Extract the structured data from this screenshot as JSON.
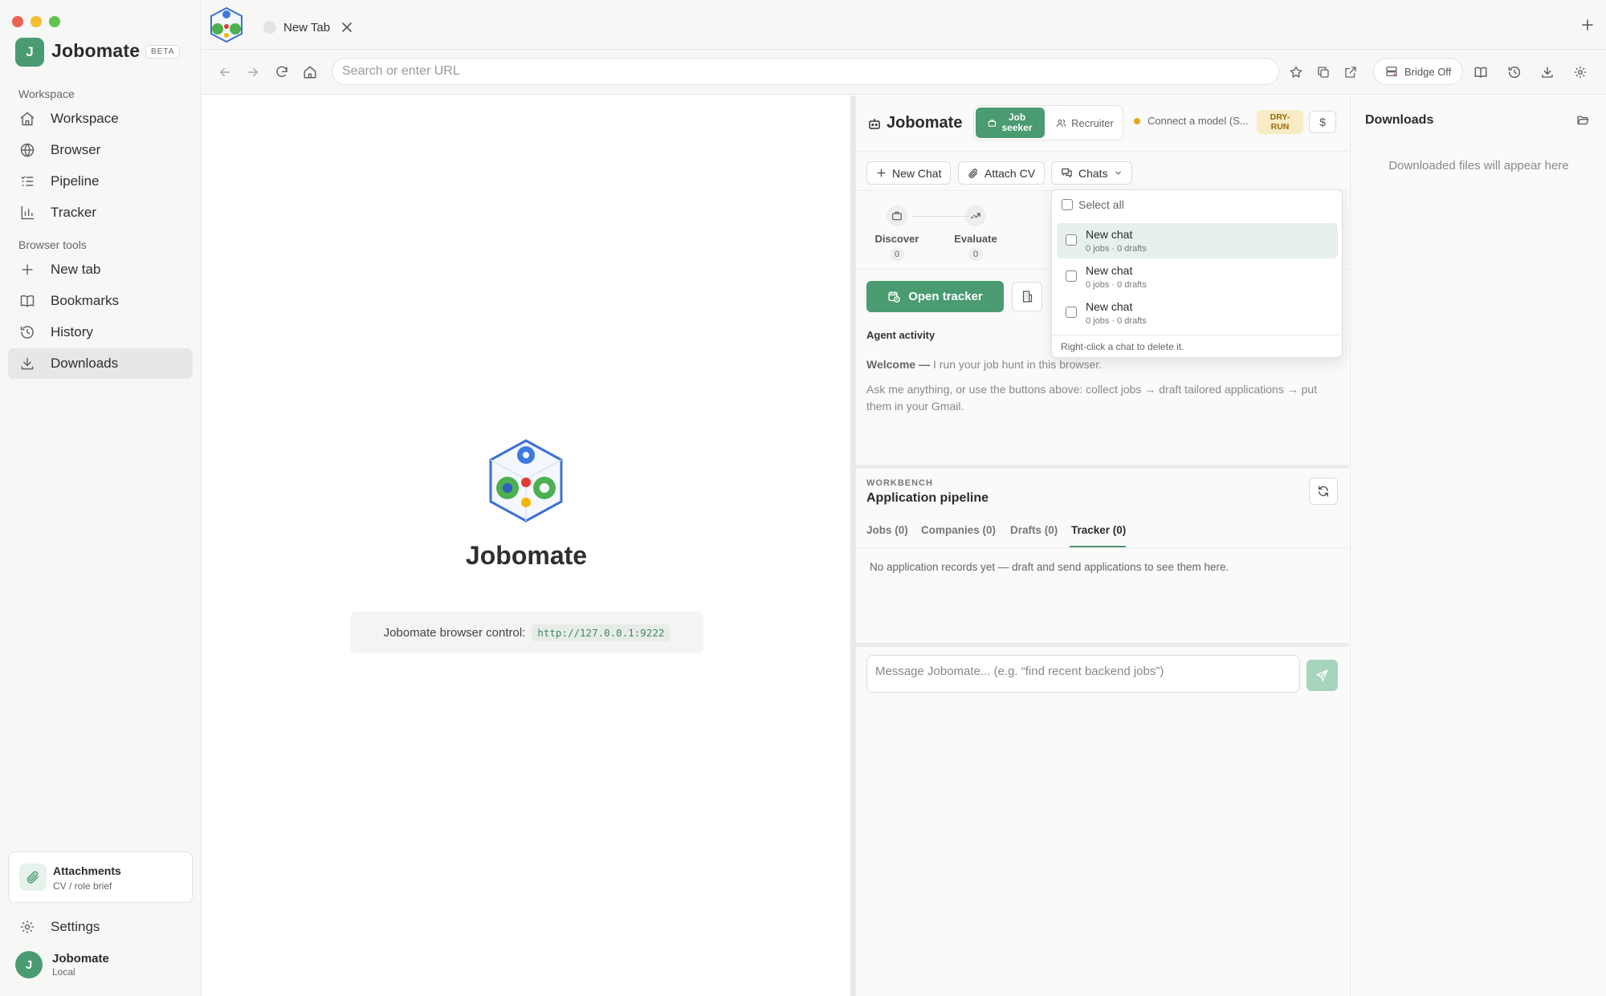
{
  "sidebar": {
    "brand": {
      "initial": "J",
      "name": "Jobomate",
      "badge": "BETA"
    },
    "workspace_label": "Workspace",
    "workspace_items": [
      {
        "label": "Workspace",
        "icon": "home-icon"
      },
      {
        "label": "Browser",
        "icon": "globe-icon"
      },
      {
        "label": "Pipeline",
        "icon": "list-icon"
      },
      {
        "label": "Tracker",
        "icon": "bar-chart-icon"
      }
    ],
    "tools_label": "Browser tools",
    "tool_items": [
      {
        "label": "New tab",
        "icon": "plus-icon"
      },
      {
        "label": "Bookmarks",
        "icon": "book-icon"
      },
      {
        "label": "History",
        "icon": "history-icon"
      },
      {
        "label": "Downloads",
        "icon": "download-icon",
        "active": true
      }
    ],
    "attachments": {
      "title": "Attachments",
      "subtitle": "CV / role brief"
    },
    "settings_label": "Settings",
    "user": {
      "initial": "J",
      "name": "Jobomate",
      "subtitle": "Local"
    }
  },
  "tabs": [
    {
      "title": "New Tab"
    }
  ],
  "toolbar": {
    "url_placeholder": "Search or enter URL",
    "bridge_label": "Bridge Off"
  },
  "newtab": {
    "title": "Jobomate",
    "control_label": "Jobomate browser control:",
    "control_url": "http://127.0.0.1:9222"
  },
  "agent": {
    "title": "Jobomate",
    "modes": {
      "active": "Job seeker",
      "inactive": "Recruiter"
    },
    "model_text": "Connect a model (S...",
    "dry_run": "DRY-RUN",
    "cost_symbol": "$",
    "actions": {
      "new_chat": "New Chat",
      "attach_cv": "Attach CV",
      "chats": "Chats"
    },
    "stages": [
      {
        "label": "Discover",
        "count": "0",
        "icon": "briefcase-icon"
      },
      {
        "label": "Evaluate",
        "count": "0",
        "icon": "trending-up-icon"
      }
    ],
    "open_tracker": "Open tracker",
    "activity_label": "Agent activity",
    "welcome_bold": "Welcome —",
    "welcome_text": "I run your job hunt in this browser.",
    "intro": "Ask me anything, or use the buttons above: collect jobs → draft tailored applications → put them in your Gmail.",
    "workbench_label": "WORKBENCH",
    "workbench_title": "Application pipeline",
    "workbench_tabs": [
      "Jobs (0)",
      "Companies (0)",
      "Drafts (0)",
      "Tracker (0)"
    ],
    "workbench_active_tab": "Tracker (0)",
    "empty_records": "No application records yet — draft and send applications to see them here.",
    "message_placeholder": "Message Jobomate...  (e.g. “find recent backend jobs”)"
  },
  "chats_dropdown": {
    "select_all": "Select all",
    "items": [
      {
        "name": "New chat",
        "meta": "0 jobs · 0 drafts",
        "highlighted": true
      },
      {
        "name": "New chat",
        "meta": "0 jobs · 0 drafts",
        "highlighted": false
      },
      {
        "name": "New chat",
        "meta": "0 jobs · 0 drafts",
        "highlighted": false
      }
    ],
    "footer": "Right-click a chat to delete it."
  },
  "downloads": {
    "title": "Downloads",
    "empty": "Downloaded files will appear here"
  },
  "colors": {
    "accent": "#4a9a72",
    "accent_light": "#a7d4bc",
    "warning": "#e8a51a",
    "dry_run_bg": "#f8ecc7"
  }
}
